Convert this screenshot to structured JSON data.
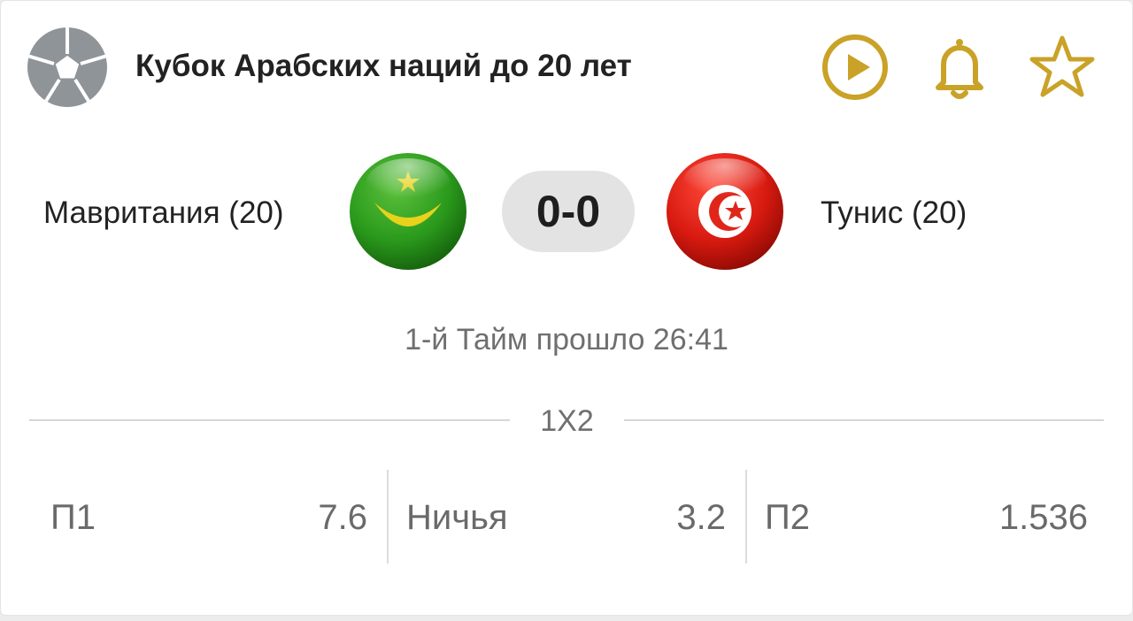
{
  "league": {
    "name": "Кубок Арабских наций до 20 лет",
    "logo_icon": "soccer-ball-icon"
  },
  "actions": {
    "play_icon": "play-circle-icon",
    "bell_icon": "bell-icon",
    "star_icon": "star-outline-icon",
    "accent_color": "#c9a227"
  },
  "match": {
    "home_team": "Мавритания (20)",
    "away_team": "Тунис (20)",
    "home_flag": "mauritania-flag",
    "away_flag": "tunisia-flag",
    "score": "0-0",
    "status": "1-й Тайм прошло 26:41"
  },
  "market": {
    "name": "1X2",
    "outcomes": [
      {
        "label": "П1",
        "odd": "7.6"
      },
      {
        "label": "Ничья",
        "odd": "3.2"
      },
      {
        "label": "П2",
        "odd": "1.536"
      }
    ]
  }
}
